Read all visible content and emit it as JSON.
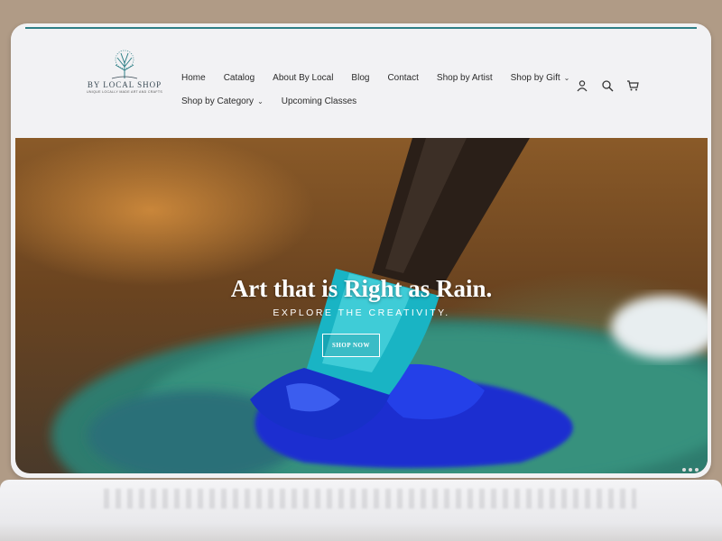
{
  "brand": {
    "name": "BY LOCAL SHOP",
    "tagline": "UNIQUE LOCALLY MADE ART AND CRAFTS"
  },
  "nav": {
    "row1": [
      {
        "label": "Home",
        "dropdown": false
      },
      {
        "label": "Catalog",
        "dropdown": false
      },
      {
        "label": "About By Local",
        "dropdown": false
      },
      {
        "label": "Blog",
        "dropdown": false
      },
      {
        "label": "Contact",
        "dropdown": false
      },
      {
        "label": "Shop by Artist",
        "dropdown": false
      },
      {
        "label": "Shop by Gift",
        "dropdown": true
      }
    ],
    "row2": [
      {
        "label": "Shop by Category",
        "dropdown": true
      },
      {
        "label": "Upcoming Classes",
        "dropdown": false
      }
    ]
  },
  "header_icons": [
    "account-icon",
    "search-icon",
    "cart-icon"
  ],
  "hero": {
    "headline": "Art that is Right as Rain.",
    "subheadline": "EXPLORE THE CREATIVITY.",
    "cta_label": "SHOP NOW"
  },
  "colors": {
    "accent": "#2e7f86",
    "paint_teal": "#1fb3b8",
    "paint_blue": "#1a2fd0"
  }
}
